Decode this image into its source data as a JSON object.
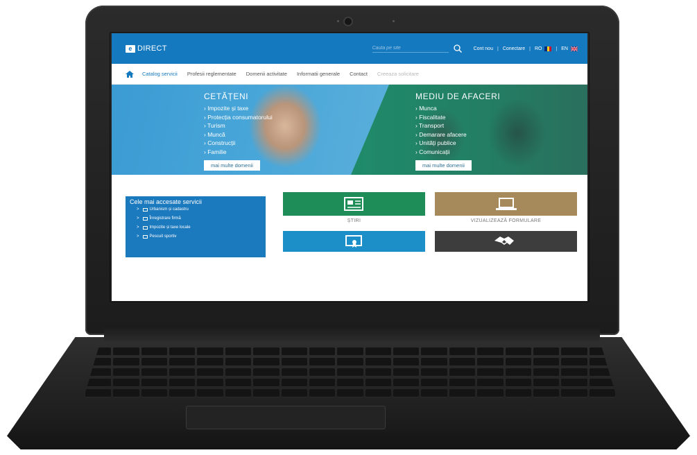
{
  "site": {
    "logo_text": "DIRECT",
    "logo_mark": "e",
    "search_placeholder": "Cauta pe site",
    "user_links": [
      "Cont nou",
      "Conectare",
      "RO",
      "EN"
    ],
    "colors": {
      "brand": "#1579bf",
      "green": "#1f8d58",
      "gold": "#a68a5c",
      "dark": "#3d3d3d"
    }
  },
  "nav": {
    "items": [
      "Catalog servicii",
      "Profesii reglementate",
      "Domenii activitate",
      "Informatii generale",
      "Contact",
      "Creeaza solicitare"
    ]
  },
  "hero": {
    "citizens": {
      "title": "CETĂȚENI",
      "items": [
        "Impozite și taxe",
        "Protecția consumatorului",
        "Turism",
        "Muncă",
        "Construcții",
        "Familie"
      ],
      "button": "mai multe domenii"
    },
    "business": {
      "title": "MEDIU DE AFACERI",
      "items": [
        "Munca",
        "Fiscalitate",
        "Transport",
        "Demarare afacere",
        "Unități publice",
        "Comunicații"
      ],
      "button": "mai multe domenii"
    }
  },
  "services": {
    "title": "Cele mai accesate servicii",
    "items": [
      "Urbanism și cadastru",
      "Înregistrare firmă",
      "Impozite și taxe locale",
      "Pescuit sportiv"
    ]
  },
  "tiles": {
    "news": "ȘTIRI",
    "forms": "VIZUALIZEAZĂ FORMULARE"
  }
}
